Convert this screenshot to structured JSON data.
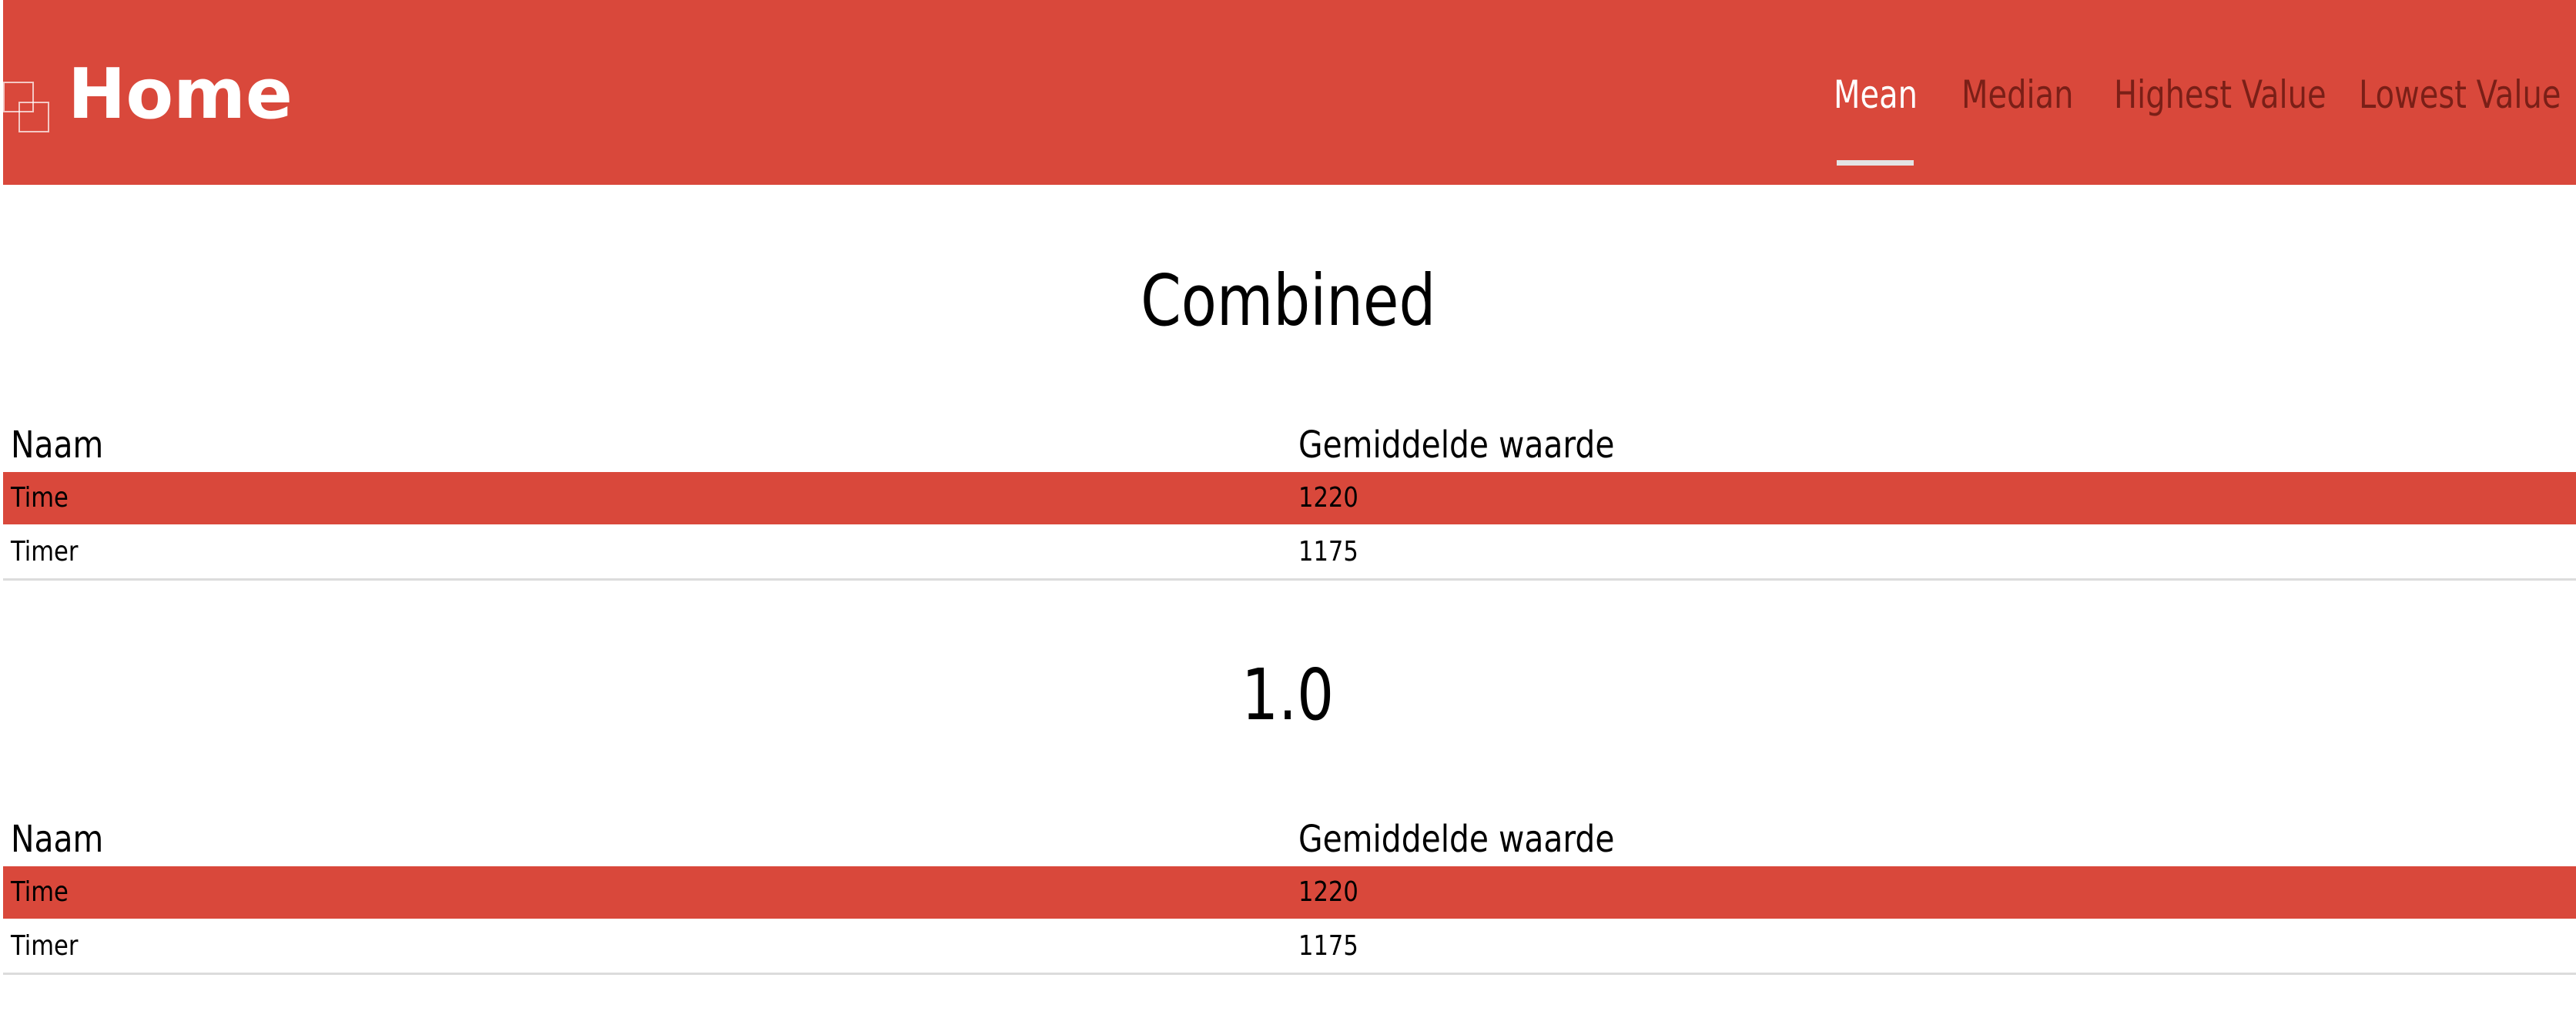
{
  "header": {
    "title": "Home",
    "nav": [
      {
        "label": "Mean",
        "active": true
      },
      {
        "label": "Median",
        "active": false
      },
      {
        "label": "Highest Value",
        "active": false
      },
      {
        "label": "Lowest Value",
        "active": false
      }
    ]
  },
  "sections": [
    {
      "title": "Combined",
      "columns": [
        "Naam",
        "Gemiddelde waarde"
      ],
      "rows": [
        {
          "name": "Time",
          "value": "1220"
        },
        {
          "name": "Timer",
          "value": "1175"
        }
      ]
    },
    {
      "title": "1.0",
      "columns": [
        "Naam",
        "Gemiddelde waarde"
      ],
      "rows": [
        {
          "name": "Time",
          "value": "1220"
        },
        {
          "name": "Timer",
          "value": "1175"
        }
      ]
    }
  ],
  "colors": {
    "accent": "#d9483b",
    "nav_inactive": "#7a1f17",
    "nav_active": "#ffffff",
    "underline": "#e4e4e4"
  },
  "icons": {
    "logo": "overlapping-squares-icon"
  }
}
